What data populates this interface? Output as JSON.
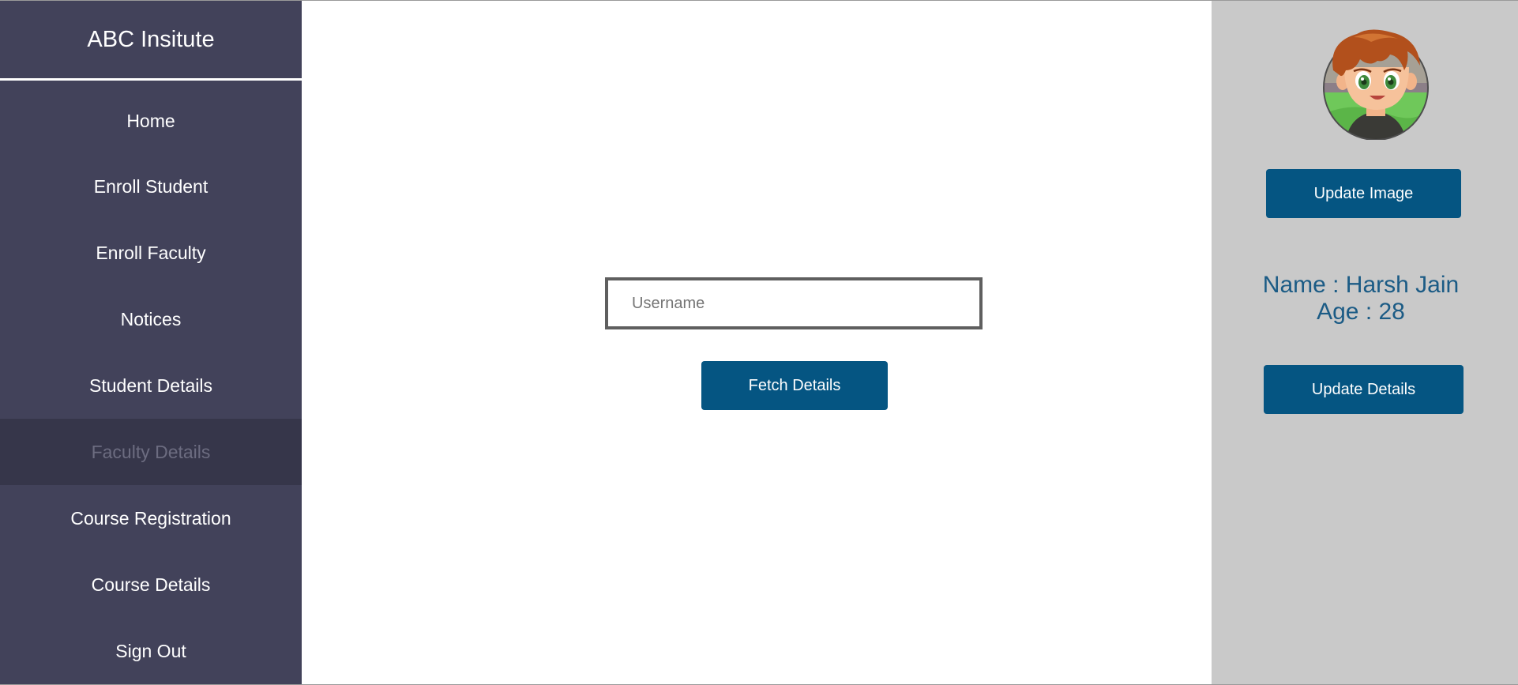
{
  "sidebar": {
    "brand": "ABC Insitute",
    "items": [
      {
        "label": "Home"
      },
      {
        "label": "Enroll Student"
      },
      {
        "label": "Enroll Faculty"
      },
      {
        "label": "Notices"
      },
      {
        "label": "Student Details"
      },
      {
        "label": "Faculty Details",
        "active": true
      },
      {
        "label": "Course Registration"
      },
      {
        "label": "Course Details"
      },
      {
        "label": "Sign Out"
      }
    ]
  },
  "main": {
    "username": {
      "placeholder": "Username",
      "value": ""
    },
    "fetch_label": "Fetch Details"
  },
  "profile": {
    "avatar_icon": "cartoon-boy-avatar-icon",
    "update_image_label": "Update Image",
    "name_line": "Name : Harsh Jain",
    "age_line": "Age : 28",
    "update_details_label": "Update Details"
  },
  "colors": {
    "sidebar_bg": "#42425a",
    "sidebar_active_bg": "#36364a",
    "button_bg": "#055582",
    "profile_bg": "#c9c9c9",
    "profile_text": "#1b5b85"
  }
}
